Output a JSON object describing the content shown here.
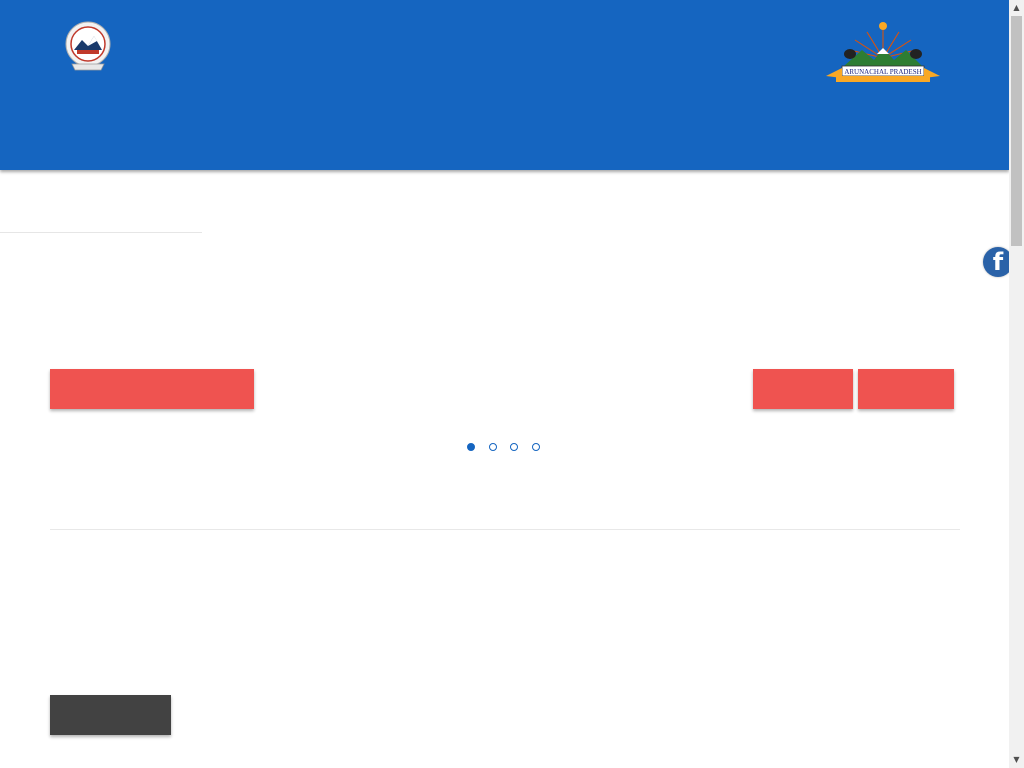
{
  "header": {
    "left_logo": {
      "icon": "police-seal-icon"
    },
    "right_logo": {
      "icon": "state-emblem-icon",
      "banner_text": "ARUNACHAL PRADESH"
    },
    "background_color": "#1565c0"
  },
  "social": {
    "facebook_label": "f",
    "icon": "facebook-icon"
  },
  "slider": {
    "primary_button_label": "",
    "prev_button_label": "",
    "next_button_label": "",
    "indicator_count": 4,
    "active_indicator": 0,
    "accent_color": "#ef5350"
  },
  "content": {
    "read_more_label": ""
  },
  "scrollbar": {
    "up_arrow": "▲",
    "down_arrow": "▼"
  }
}
